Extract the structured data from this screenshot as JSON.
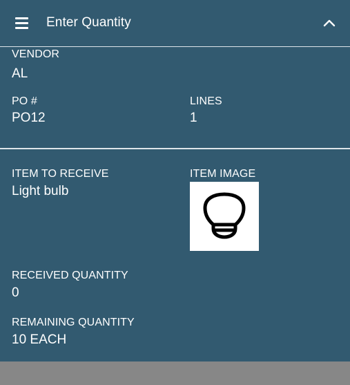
{
  "header": {
    "title": "Enter Quantity",
    "menu_icon": "hamburger-menu-icon",
    "collapse_icon": "chevron-up-icon"
  },
  "po_info": {
    "vendor_label": "VENDOR",
    "vendor_value": "AL",
    "po_label": "PO #",
    "po_value": "PO12",
    "lines_label": "LINES",
    "lines_value": "1"
  },
  "item": {
    "item_label": "ITEM TO RECEIVE",
    "item_value": "Light bulb",
    "image_label": "ITEM IMAGE",
    "image_icon": "light-bulb-icon",
    "received_label": "RECEIVED QUANTITY",
    "received_value": "0",
    "remaining_label": "REMAINING QUANTITY",
    "remaining_value": "10 EACH"
  },
  "colors": {
    "panel_bg": "#325a70",
    "footer_bg": "#878787",
    "text": "#ffffff"
  }
}
